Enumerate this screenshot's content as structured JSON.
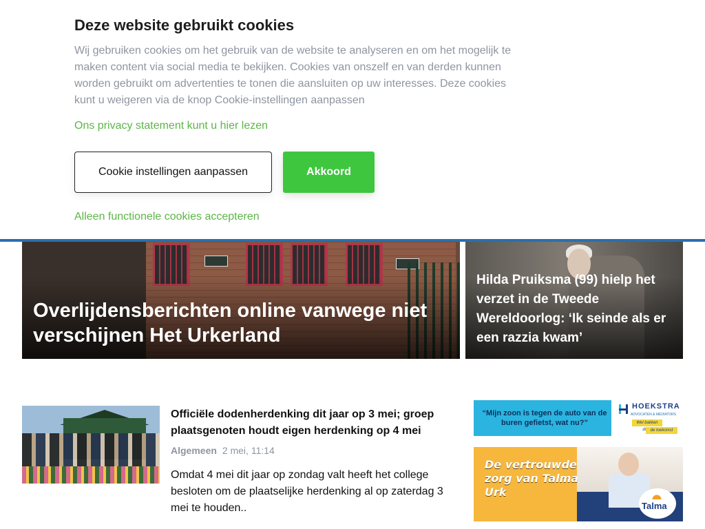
{
  "cookie_banner": {
    "title": "Deze website gebruikt cookies",
    "description": "Wij gebruiken cookies om het gebruik van de website te analyseren en om het mogelijk te maken content via social media te bekijken. Cookies van onszelf en van derden kunnen worden gebruikt om advertenties te tonen die aansluiten op uw interesses. Deze cookies kunt u weigeren via de knop Cookie-instellingen aanpassen",
    "privacy_link": "Ons privacy statement kunt u hier lezen",
    "settings_button": "Cookie instellingen aanpassen",
    "accept_button": "Akkoord",
    "functional_link": "Alleen functionele cookies accepteren"
  },
  "featured": [
    {
      "title": "Overlijdensberichten online vanwege niet verschijnen Het Urkerland"
    },
    {
      "title": "Hilda Pruiksma (99) hielp het verzet in de Tweede Wereldoorlog: ‘Ik seinde als er een razzia kwam’"
    }
  ],
  "article": {
    "title": "Officiële dodenherdenking dit jaar op 3 mei; groep plaatsgenoten houdt eigen herdenking op 4 mei",
    "category": "Algemeen",
    "date": "2 mei, 11:14",
    "excerpt": "Omdat 4 mei dit jaar op zondag valt heeft het college besloten om de plaatselijke herdenking al op zaterdag 3 mei te houden.."
  },
  "ads": {
    "hoekstra": {
      "quote": "“Mijn zoon is tegen de auto van de buren gefietst, wat nu?”",
      "brand": "HOEKSTRA",
      "sub": "ADVOCATEN & MEDIATORS",
      "tag1": "Wel bakken doen",
      "tag2": "de toekomst"
    },
    "talma": {
      "slogan": "De vertrouwde zorg van Talma Urk",
      "logo": "Talma"
    }
  },
  "colors": {
    "accent_green": "#3fc63f",
    "link_green": "#5cb547",
    "divider_blue": "#2a6fb0",
    "muted_text": "#8e95a0"
  }
}
